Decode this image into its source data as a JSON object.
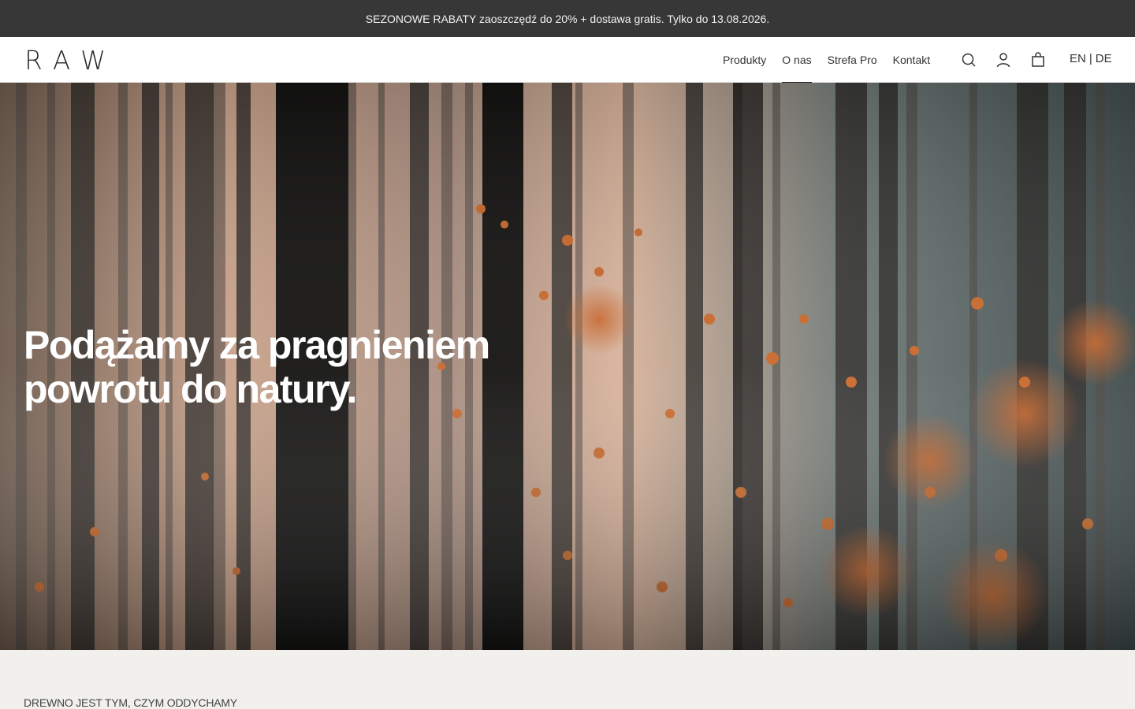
{
  "promo": {
    "text": "SEZONOWE RABATY zaoszczędź do 20% + dostawa gratis. Tylko do 13.08.2026."
  },
  "header": {
    "logo": "RAW",
    "nav": [
      {
        "label": "Produkty",
        "active": false
      },
      {
        "label": "O nas",
        "active": true
      },
      {
        "label": "Strefa Pro",
        "active": false
      },
      {
        "label": "Kontakt",
        "active": false
      }
    ],
    "icons": [
      "search-icon",
      "account-icon",
      "cart-icon"
    ],
    "languages": {
      "en": "EN",
      "separator": "|",
      "de": "DE"
    }
  },
  "hero": {
    "title_line1": "Podążamy za pragnieniem",
    "title_line2": "powrotu do natury."
  },
  "section": {
    "label": "DREWNO JEST TYM, CZYM ODDYCHAMY"
  },
  "colors": {
    "promo_bg": "#373737",
    "header_bg": "#ffffff",
    "page_bg": "#f1f0ec",
    "foliage": "#c7652a"
  }
}
